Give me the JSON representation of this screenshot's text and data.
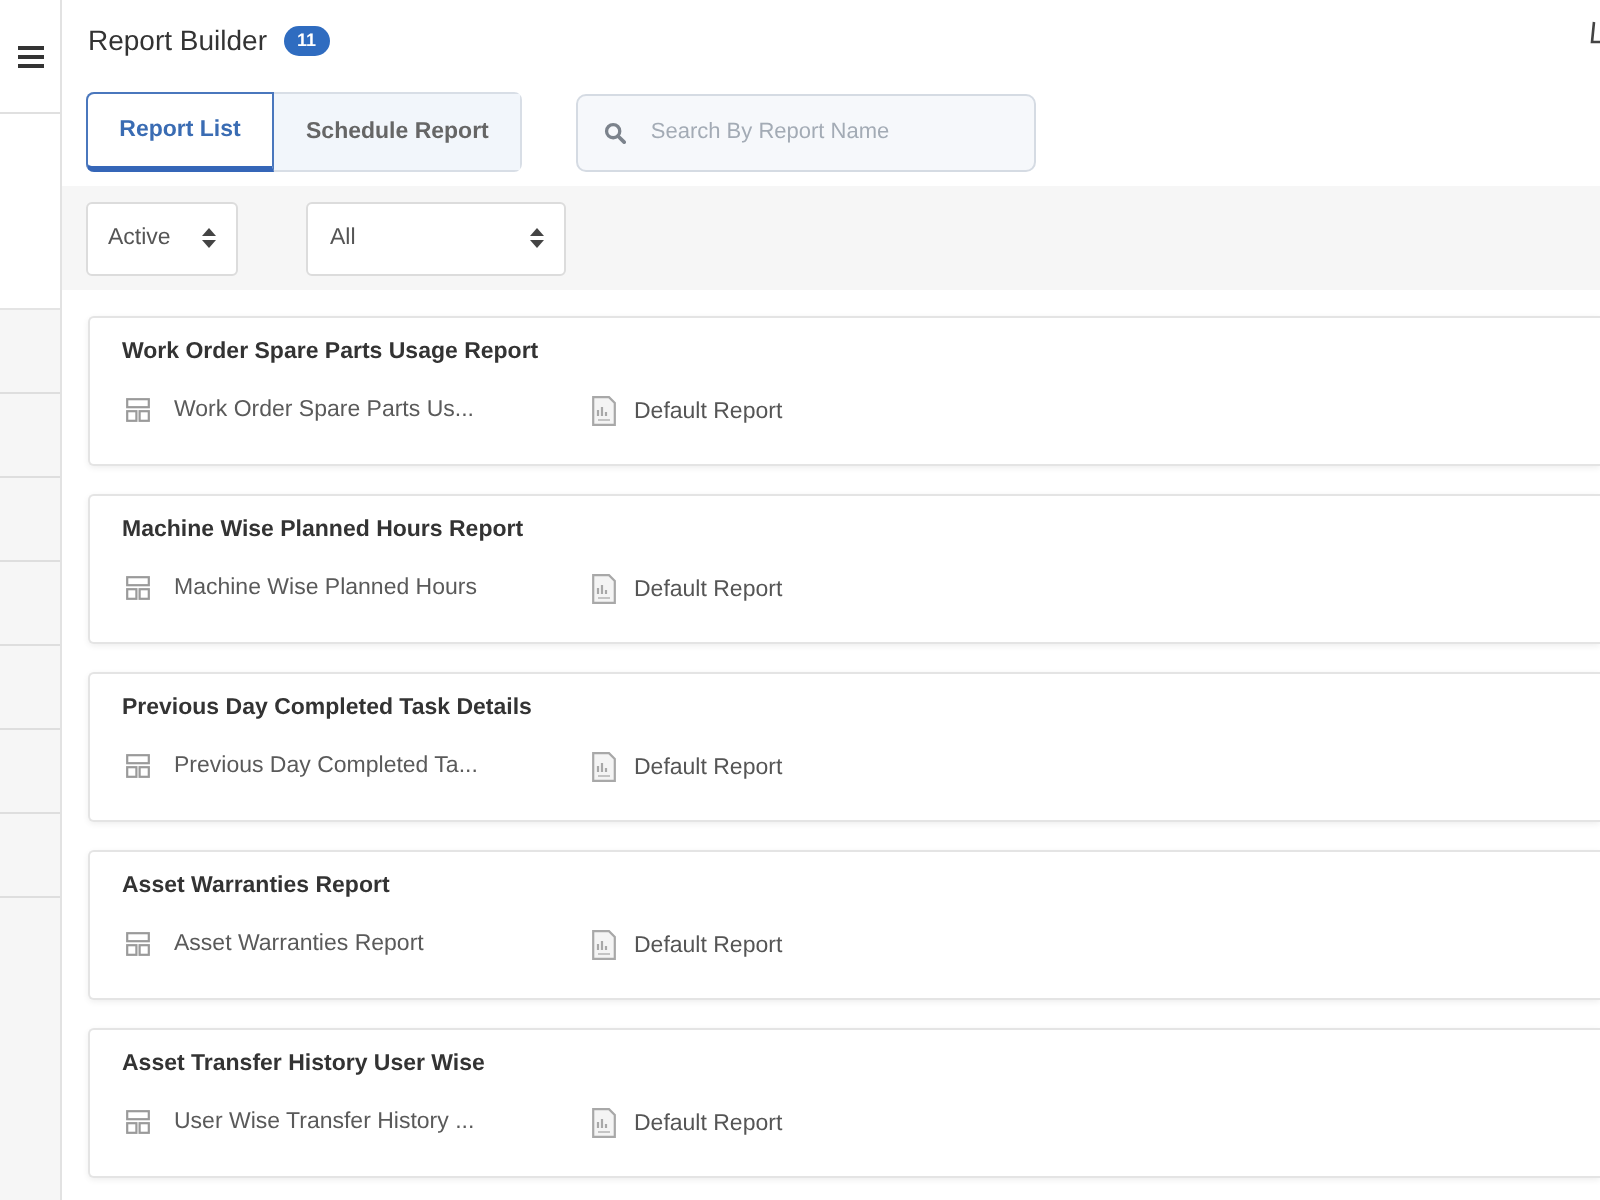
{
  "header": {
    "title": "Report Builder",
    "count": "11"
  },
  "tabs": [
    {
      "label": "Report List",
      "selected": true
    },
    {
      "label": "Schedule Report",
      "selected": false
    }
  ],
  "search": {
    "placeholder": "Search By Report Name"
  },
  "filters": [
    {
      "value": "Active"
    },
    {
      "value": "All"
    }
  ],
  "reports": [
    {
      "title": "Work Order Spare Parts Usage Report",
      "name": "Work Order Spare Parts Us...",
      "type": "Default Report"
    },
    {
      "title": "Machine Wise Planned Hours Report",
      "name": "Machine Wise Planned Hours",
      "type": "Default Report"
    },
    {
      "title": "Previous Day Completed Task Details",
      "name": "Previous Day Completed Ta...",
      "type": "Default Report"
    },
    {
      "title": "Asset Warranties Report",
      "name": "Asset Warranties Report",
      "type": "Default Report"
    },
    {
      "title": "Asset Transfer History User Wise",
      "name": "User Wise Transfer History ...",
      "type": "Default Report"
    }
  ]
}
